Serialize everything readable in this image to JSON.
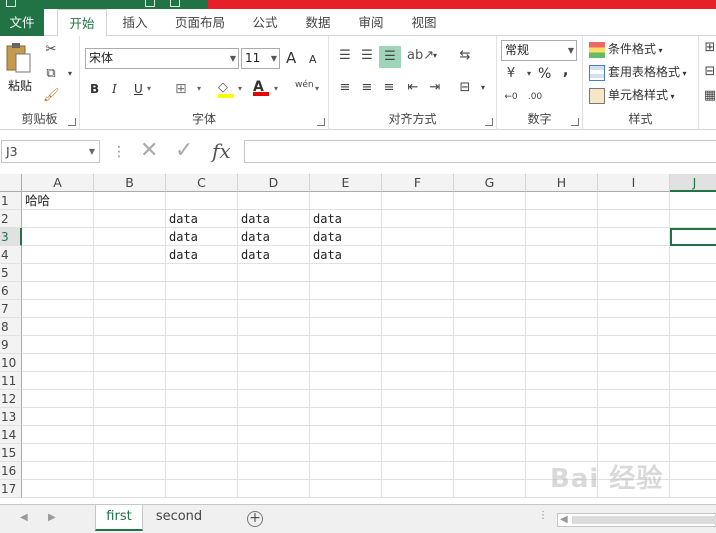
{
  "ribbon_tabs": [
    "文件",
    "开始",
    "插入",
    "页面布局",
    "公式",
    "数据",
    "审阅",
    "视图"
  ],
  "clipboard": {
    "paste": "粘贴",
    "label": "剪贴板"
  },
  "font": {
    "name": "宋体",
    "size": "11",
    "label": "字体",
    "bold": "B",
    "italic": "I",
    "underline": "U",
    "grow": "A",
    "shrink": "A",
    "phonetic": "wén"
  },
  "alignment": {
    "label": "对齐方式"
  },
  "number": {
    "format": "常规",
    "percent": "%",
    "comma": ",",
    "label": "数字"
  },
  "styles": {
    "conditional": "条件格式",
    "table": "套用表格格式",
    "cell": "单元格样式",
    "label": "样式"
  },
  "formula_bar": {
    "name_box": "J3",
    "cancel": "✕",
    "enter": "✓",
    "fx": "fx",
    "value": ""
  },
  "columns": [
    "A",
    "B",
    "C",
    "D",
    "E",
    "F",
    "G",
    "H",
    "I",
    "J"
  ],
  "rows": [
    "1",
    "2",
    "3",
    "4",
    "5",
    "6",
    "7",
    "8",
    "9",
    "10",
    "11",
    "12",
    "13",
    "14",
    "15",
    "16",
    "17"
  ],
  "cells": {
    "A1": "哈哈",
    "C2": "data",
    "D2": "data",
    "E2": "data",
    "C3": "data",
    "D3": "data",
    "E3": "data",
    "C4": "data",
    "D4": "data",
    "E4": "data"
  },
  "sheets": [
    "first",
    "second"
  ],
  "active_sheet": "first",
  "watermark": "Bai 经验",
  "colors": {
    "accent": "#217346",
    "title_red": "#e61f28"
  }
}
